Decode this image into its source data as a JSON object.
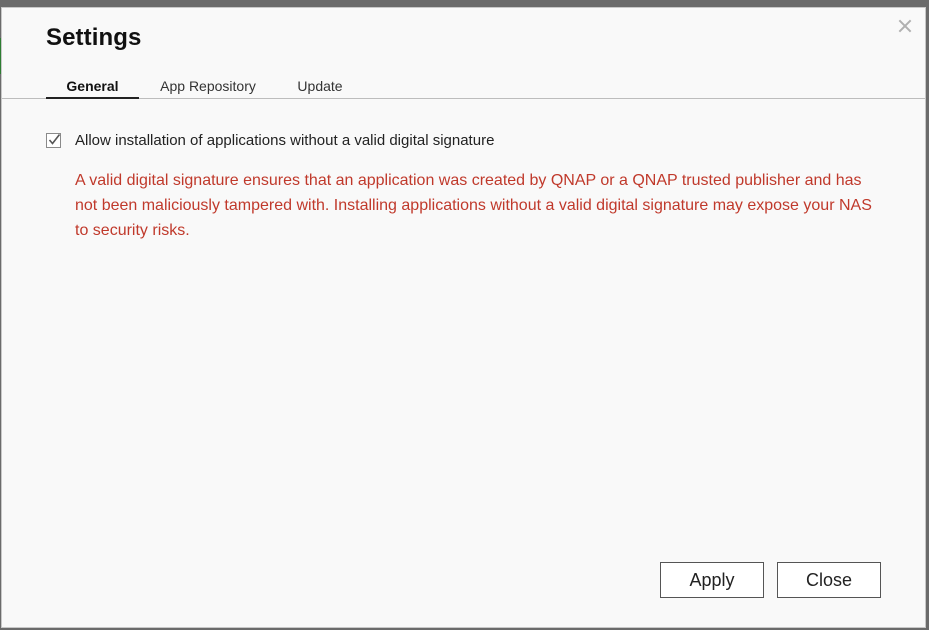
{
  "dialog": {
    "title": "Settings"
  },
  "tabs": [
    {
      "label": "General",
      "active": true
    },
    {
      "label": "App Repository",
      "active": false
    },
    {
      "label": "Update",
      "active": false
    }
  ],
  "general": {
    "allow_unsigned": {
      "checked": true,
      "label": "Allow installation of applications without a valid digital signature"
    },
    "warning_text": "A valid digital signature ensures that an application was created by QNAP or a QNAP trusted publisher and has not been maliciously tampered with. Installing applications without a valid digital signature may expose your NAS to security risks."
  },
  "footer": {
    "apply_label": "Apply",
    "close_label": "Close"
  },
  "colors": {
    "warning": "#c0392b",
    "dialog_bg": "#f9f9f9"
  },
  "icons": {
    "close": "close-icon",
    "checkbox": "checkmark-icon"
  }
}
